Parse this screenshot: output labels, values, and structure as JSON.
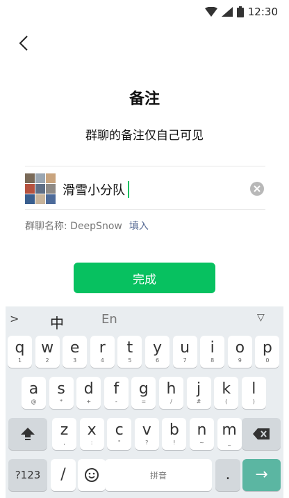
{
  "status": {
    "time": "12:30"
  },
  "header": {
    "title": "备注",
    "subtitle": "群聊的备注仅自己可见"
  },
  "remark": {
    "value": "滑雪小分队"
  },
  "group_name": {
    "label": "群聊名称: DeepSnow",
    "fill_action": "填入"
  },
  "done_button": {
    "label": "完成"
  },
  "keyboard": {
    "top_bar": {
      "expand": ">",
      "chinese": "中",
      "english": "En",
      "collapse": "▽"
    },
    "row1": [
      {
        "main": "q",
        "sub": "1"
      },
      {
        "main": "w",
        "sub": "2"
      },
      {
        "main": "e",
        "sub": "3"
      },
      {
        "main": "r",
        "sub": "4"
      },
      {
        "main": "t",
        "sub": "5"
      },
      {
        "main": "y",
        "sub": "6"
      },
      {
        "main": "u",
        "sub": "7"
      },
      {
        "main": "i",
        "sub": "8"
      },
      {
        "main": "o",
        "sub": "9"
      },
      {
        "main": "p",
        "sub": "0"
      }
    ],
    "row2": [
      {
        "main": "a",
        "sub": "@"
      },
      {
        "main": "s",
        "sub": "*"
      },
      {
        "main": "d",
        "sub": "+"
      },
      {
        "main": "f",
        "sub": "-"
      },
      {
        "main": "g",
        "sub": "="
      },
      {
        "main": "h",
        "sub": "/"
      },
      {
        "main": "j",
        "sub": "#"
      },
      {
        "main": "k",
        "sub": "("
      },
      {
        "main": "l",
        "sub": ")"
      }
    ],
    "row3": [
      {
        "main": "z",
        "sub": ","
      },
      {
        "main": "x",
        "sub": ":"
      },
      {
        "main": "c",
        "sub": "\""
      },
      {
        "main": "v",
        "sub": "?"
      },
      {
        "main": "b",
        "sub": "!"
      },
      {
        "main": "n",
        "sub": "~"
      },
      {
        "main": "m",
        "sub": "_"
      }
    ],
    "numbers_label": "?123",
    "slash_label": "/",
    "space_label": "拼音",
    "period_label": ".",
    "enter_label": "→"
  },
  "colors": {
    "accent": "#07c160",
    "link": "#576b95"
  }
}
